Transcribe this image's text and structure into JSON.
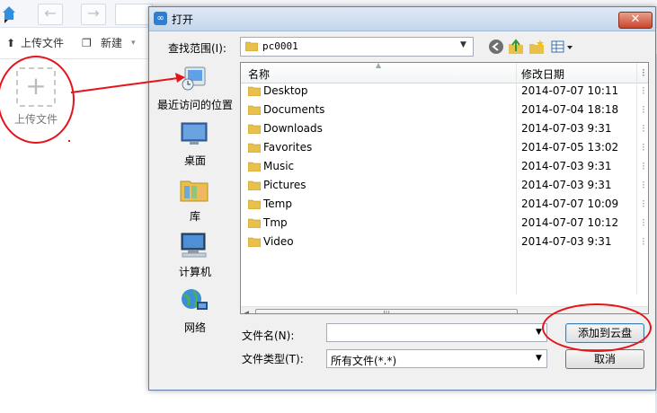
{
  "background_app": {
    "actions": {
      "upload_label": "上传文件",
      "new_label": "新建"
    },
    "upload_tile": {
      "plus": "+",
      "label": "上传文件"
    }
  },
  "dialog": {
    "title": "打开",
    "close_symbol": "✕",
    "lookin": {
      "label": "查找范围(I):",
      "value": "pc0001"
    },
    "places": [
      {
        "label": "最近访问的位置",
        "icon": "recent-places-icon"
      },
      {
        "label": "桌面",
        "icon": "desktop-icon"
      },
      {
        "label": "库",
        "icon": "libraries-icon"
      },
      {
        "label": "计算机",
        "icon": "computer-icon"
      },
      {
        "label": "网络",
        "icon": "network-icon"
      }
    ],
    "columns": {
      "name": "名称",
      "modified": "修改日期"
    },
    "files": [
      {
        "name": "Desktop",
        "modified": "2014-07-07 10:11"
      },
      {
        "name": "Documents",
        "modified": "2014-07-04 18:18"
      },
      {
        "name": "Downloads",
        "modified": "2014-07-03 9:31"
      },
      {
        "name": "Favorites",
        "modified": "2014-07-05 13:02"
      },
      {
        "name": "Music",
        "modified": "2014-07-03 9:31"
      },
      {
        "name": "Pictures",
        "modified": "2014-07-03 9:31"
      },
      {
        "name": "Temp",
        "modified": "2014-07-07 10:09"
      },
      {
        "name": "Tmp",
        "modified": "2014-07-07 10:12"
      },
      {
        "name": "Video",
        "modified": "2014-07-03 9:31"
      }
    ],
    "filename": {
      "label": "文件名(N):",
      "value": ""
    },
    "filetype": {
      "label": "文件类型(T):",
      "value": "所有文件(*.*)"
    },
    "buttons": {
      "add": "添加到云盘",
      "cancel": "取消"
    }
  },
  "colors": {
    "folder": "#e8c04a",
    "annotation_red": "#e5141b",
    "title_bar": "#c4d6ec"
  }
}
